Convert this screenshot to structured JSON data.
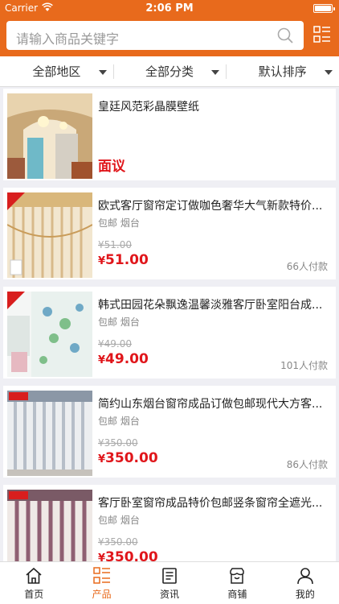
{
  "status": {
    "carrier": "Carrier",
    "time": "2:06 PM"
  },
  "search": {
    "placeholder": "请输入商品关键字"
  },
  "filters": [
    {
      "label": "全部地区"
    },
    {
      "label": "全部分类"
    },
    {
      "label": "默认排序"
    }
  ],
  "products": [
    {
      "title": "皇廷风范彩晶膜壁纸",
      "tags": "",
      "old_price": "",
      "price": "面议",
      "sold": ""
    },
    {
      "title": "欧式客厅窗帘定订做咖色奢华大气新款特价...",
      "tags": "包邮  烟台",
      "old_price": "¥51.00",
      "price": "51.00",
      "sold": "66人付款"
    },
    {
      "title": "韩式田园花朵飘逸温馨淡雅客厅卧室阳台成...",
      "tags": "包邮  烟台",
      "old_price": "¥49.00",
      "price": "49.00",
      "sold": "101人付款"
    },
    {
      "title": "简约山东烟台窗帘成品订做包邮现代大方客...",
      "tags": "包邮  烟台",
      "old_price": "¥350.00",
      "price": "350.00",
      "sold": "86人付款"
    },
    {
      "title": "客厅卧室窗帘成品特价包邮竖条窗帘全遮光...",
      "tags": "包邮  烟台",
      "old_price": "¥350.00",
      "price": "350.00",
      "sold": ""
    }
  ],
  "currency": "¥",
  "tabs": [
    {
      "label": "首页",
      "icon": "home-icon"
    },
    {
      "label": "产品",
      "icon": "list-icon"
    },
    {
      "label": "资讯",
      "icon": "news-icon"
    },
    {
      "label": "商铺",
      "icon": "shop-icon"
    },
    {
      "label": "我的",
      "icon": "user-icon"
    }
  ],
  "colors": {
    "accent": "#e86a1c",
    "price": "#e0161b"
  }
}
